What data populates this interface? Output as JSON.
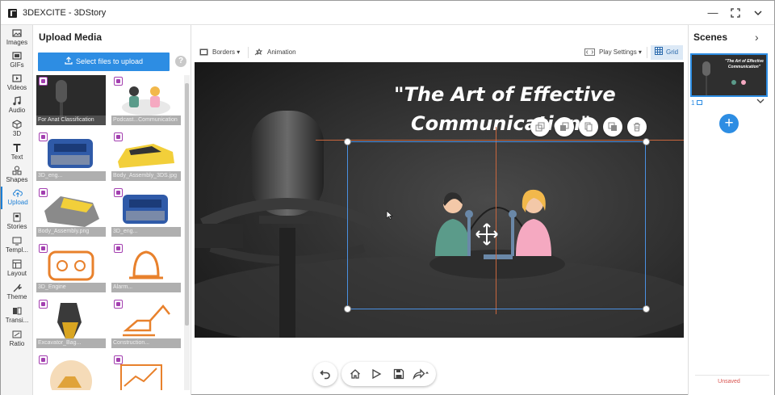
{
  "window": {
    "title": "3DEXCITE - 3DStory",
    "controls": [
      "minimize-icon",
      "fullscreen-icon",
      "chevron-down-icon"
    ]
  },
  "rail": {
    "items": [
      {
        "label": "Images",
        "icon": "image-icon"
      },
      {
        "label": "GIFs",
        "icon": "gif-icon"
      },
      {
        "label": "Videos",
        "icon": "video-icon"
      },
      {
        "label": "Audio",
        "icon": "music-note-icon"
      },
      {
        "label": "3D",
        "icon": "cube-icon"
      },
      {
        "label": "Text",
        "icon": "text-icon"
      },
      {
        "label": "Shapes",
        "icon": "shapes-icon"
      },
      {
        "label": "Upload",
        "icon": "upload-cloud-icon",
        "active": true
      },
      {
        "label": "Stories",
        "icon": "stories-icon"
      },
      {
        "label": "Templ...",
        "icon": "template-icon"
      },
      {
        "label": "Layout",
        "icon": "layout-icon"
      },
      {
        "label": "Theme",
        "icon": "theme-icon"
      },
      {
        "label": "Transi...",
        "icon": "transition-icon"
      },
      {
        "label": "Ratio",
        "icon": "ratio-icon"
      }
    ]
  },
  "media_panel": {
    "title": "Upload Media",
    "upload_button": "Select files to upload",
    "help": "?",
    "items": [
      {
        "caption": "For Anat Classification"
      },
      {
        "caption": "Podcast...Communication"
      },
      {
        "caption": "3D_eng..."
      },
      {
        "caption": "Body_Assembly_3DS.jpg"
      },
      {
        "caption": "Body_Assembly.png"
      },
      {
        "caption": "3D_eng..."
      },
      {
        "caption": "3D_Engine"
      },
      {
        "caption": "Alarm..."
      },
      {
        "caption": "Excavator_Bag..."
      },
      {
        "caption": "Construction..."
      },
      {
        "caption": ""
      },
      {
        "caption": ""
      }
    ]
  },
  "toolbar": {
    "borders": "Borders",
    "animation": "Animation",
    "play_settings": "Play Settings",
    "grid": "Grid"
  },
  "slide": {
    "title_line1": "\"The Art of Effective",
    "title_line2": "Communication\""
  },
  "scenes": {
    "title": "Scenes",
    "scene_number": "1",
    "add": "+",
    "status": "Unsaved",
    "thumb_title_1": "\"The Art of Effective",
    "thumb_title_2": "Communication\""
  },
  "colors": {
    "accent": "#2d8de3",
    "badge": "#a33fb0",
    "guide": "#c8663d",
    "selection": "#4a90e2",
    "unsaved": "#d9534f"
  }
}
